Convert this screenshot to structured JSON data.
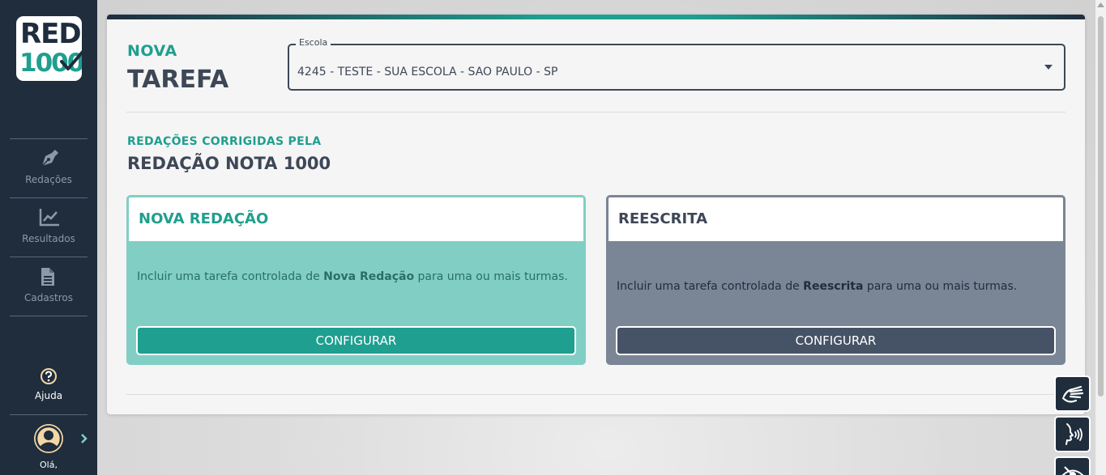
{
  "brand": {
    "logo_line1": "RED",
    "logo_line2": "1000"
  },
  "sidebar": {
    "items": [
      {
        "label": "Redações",
        "icon": "pen-nib-icon"
      },
      {
        "label": "Resultados",
        "icon": "line-chart-icon"
      },
      {
        "label": "Cadastros",
        "icon": "document-icon"
      }
    ],
    "help_label": "Ajuda",
    "user_greeting": "Olá,"
  },
  "header": {
    "title_small": "NOVA",
    "title_big": "TAREFA"
  },
  "school_select": {
    "legend": "Escola",
    "value": "4245 - TESTE - SUA ESCOLA - SAO PAULO - SP"
  },
  "section": {
    "subtitle_small": "REDAÇÕES CORRIGIDAS PELA",
    "subtitle_big": "REDAÇÃO NOTA 1000"
  },
  "tasks": [
    {
      "title": "NOVA REDAÇÃO",
      "desc_pre": "Incluir uma tarefa controlada de ",
      "desc_bold": "Nova Redação",
      "desc_post": " para uma ou mais turmas.",
      "button": "CONFIGURAR"
    },
    {
      "title": "REESCRITA",
      "desc_pre": "Incluir uma tarefa controlada de ",
      "desc_bold": "Reescrita",
      "desc_post": " para uma ou mais turmas.",
      "button": "CONFIGURAR"
    }
  ],
  "accessibility": {
    "buttons": [
      "sign-language-icon",
      "voice-reader-icon",
      "hide-eye-icon"
    ]
  },
  "colors": {
    "sidebar": "#1f2d3d",
    "accent": "#1f9f8f",
    "heading": "#3d4757"
  }
}
